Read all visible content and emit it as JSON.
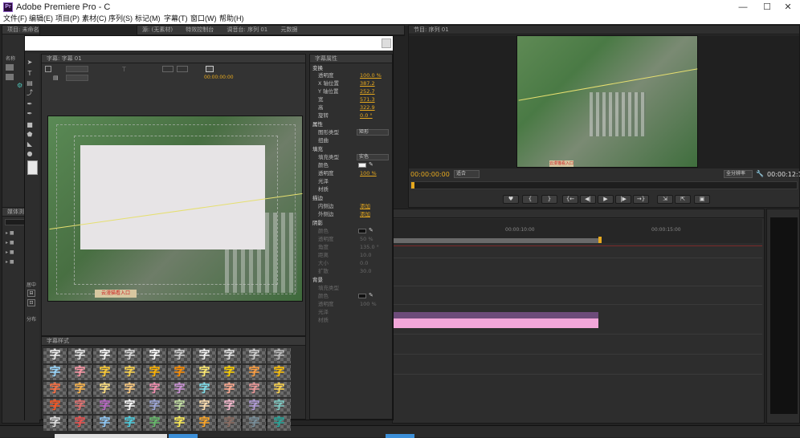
{
  "window": {
    "title": "Adobe Premiere Pro - C",
    "app_icon_text": "Pr",
    "min": "—",
    "max": "☐",
    "close": "✕"
  },
  "menu": [
    {
      "label": "文件(F)"
    },
    {
      "label": "编辑(E)"
    },
    {
      "label": "项目(P)"
    },
    {
      "label": "素材(C)"
    },
    {
      "label": "序列(S)"
    },
    {
      "label": "标记(M)"
    },
    {
      "label": "字幕(T)"
    },
    {
      "label": "窗口(W)"
    },
    {
      "label": "帮助(H)"
    }
  ],
  "tabs": {
    "project": "项目: 未命名",
    "source": "源: (无素材)",
    "effect_controls": "特效控制台",
    "audio_mixer": "调音台: 序列 01",
    "metadata": "元数据",
    "program": "节目: 序列 01"
  },
  "left_panel": {
    "name_header": "名称",
    "media_browser": "媒体浏览",
    "effects_label": "效果",
    "sections": [
      "居中",
      "分布"
    ]
  },
  "title_designer": {
    "tab": "字幕: 字幕 01",
    "timecode": "00:00:00:00",
    "font_glyph": "T",
    "caption_text": "云漫猫看入口"
  },
  "title_properties": {
    "header": "字幕属性",
    "transform": "变换",
    "rows_transform": [
      {
        "label": "透明度",
        "value": "100.0 %"
      },
      {
        "label": "X 轴位置",
        "value": "387.2"
      },
      {
        "label": "Y 轴位置",
        "value": "252.7"
      },
      {
        "label": "宽",
        "value": "571.3"
      },
      {
        "label": "高",
        "value": "322.9"
      },
      {
        "label": "旋转",
        "value": "0.0 °"
      }
    ],
    "attributes": "属性",
    "shape_type_label": "图形类型",
    "shape_type_value": "矩形",
    "distort": "扭曲",
    "fill": "填充",
    "fill_type_label": "填充类型",
    "fill_type_value": "实色",
    "color_label": "颜色",
    "fill_opacity_label": "透明度",
    "fill_opacity_value": "100 %",
    "sheen": "光泽",
    "texture": "材质",
    "strokes": "描边",
    "inner_stroke": "内侧边",
    "outer_stroke": "外侧边",
    "add_label": "添加",
    "shadow": "阴影",
    "shadow_rows": [
      {
        "label": "颜色",
        "value": ""
      },
      {
        "label": "透明度",
        "value": "50 %"
      },
      {
        "label": "角度",
        "value": "135.0 °"
      },
      {
        "label": "距离",
        "value": "10.0"
      },
      {
        "label": "大小",
        "value": "0.0"
      },
      {
        "label": "扩散",
        "value": "30.0"
      }
    ],
    "background": "背景",
    "bg_fill_type": "填充类型",
    "bg_color": "颜色",
    "bg_opacity_label": "透明度",
    "bg_opacity_value": "100 %",
    "bg_sheen": "光泽",
    "bg_texture": "材质"
  },
  "title_styles": {
    "header": "字幕样式",
    "glyph": "字"
  },
  "program_monitor": {
    "timecode_left": "00:00:00:00",
    "fit": "适合",
    "quality": "全分辨率",
    "timecode_right": "00:00:12:15",
    "buttons": [
      "♥",
      "{",
      "}",
      "{←",
      "◀|",
      "▶",
      "|▶",
      "→}",
      "⇲",
      "⇱",
      "▣"
    ]
  },
  "timeline": {
    "ruler_10": "00:00:10:00",
    "ruler_15": "00:00:15:00"
  },
  "colors": {
    "accent": "#e7a91e",
    "clip_pink": "#f2a6d9",
    "clip_purple": "#6d4b7a",
    "panel_bg": "#2d2d2d"
  }
}
